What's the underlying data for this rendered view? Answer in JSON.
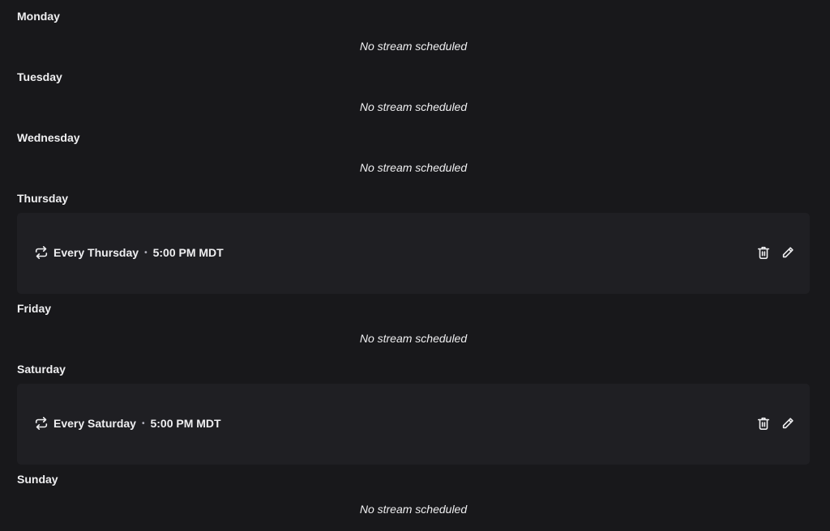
{
  "days": [
    {
      "name": "Monday",
      "empty_text": "No stream scheduled"
    },
    {
      "name": "Tuesday",
      "empty_text": "No stream scheduled"
    },
    {
      "name": "Wednesday",
      "empty_text": "No stream scheduled"
    },
    {
      "name": "Thursday",
      "segment": {
        "recurrence": "Every Thursday",
        "separator": "•",
        "time": "5:00 PM MDT"
      }
    },
    {
      "name": "Friday",
      "empty_text": "No stream scheduled"
    },
    {
      "name": "Saturday",
      "segment": {
        "recurrence": "Every Saturday",
        "separator": "•",
        "time": "5:00 PM MDT"
      }
    },
    {
      "name": "Sunday",
      "empty_text": "No stream scheduled"
    }
  ],
  "icons": {
    "repeat": "repeat-icon",
    "delete": "trash-icon",
    "edit": "pencil-icon"
  },
  "colors": {
    "background": "#18181b",
    "card": "#1f1f23",
    "text": "#efeff1"
  }
}
